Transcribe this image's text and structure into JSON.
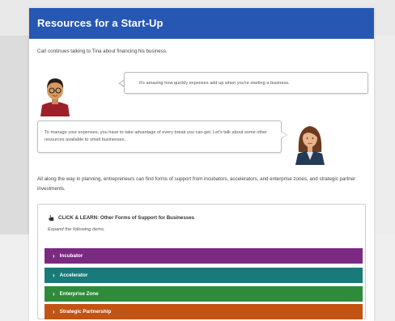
{
  "header": {
    "title": "Resources for a Start-Up"
  },
  "intro": "Carl continues talking to Tina about financing his business.",
  "dialog": {
    "carl_line": "It's amazing how quickly expenses add up when you're starting a business.",
    "tina_line": "To manage your expenses, you have to take advantage of every break you can get. Let's talk about some other resources available to small businesses."
  },
  "paragraph": "All along the way in planning, entrepreneurs can find forms of support from incubators, accelerators, and enterprise zones, and strategic partner investments.",
  "click_learn": {
    "title": "CLICK & LEARN: Other Forms of Support for Businesses",
    "subtitle": "Expand the following items.",
    "items": [
      {
        "label": "Incubator",
        "color": "#7b2a82"
      },
      {
        "label": "Accelerator",
        "color": "#187a79"
      },
      {
        "label": "Enterprise Zone",
        "color": "#2e8b3a"
      },
      {
        "label": "Strategic Partnership",
        "color": "#c25313"
      }
    ]
  },
  "colors": {
    "header": "#2658b3"
  }
}
